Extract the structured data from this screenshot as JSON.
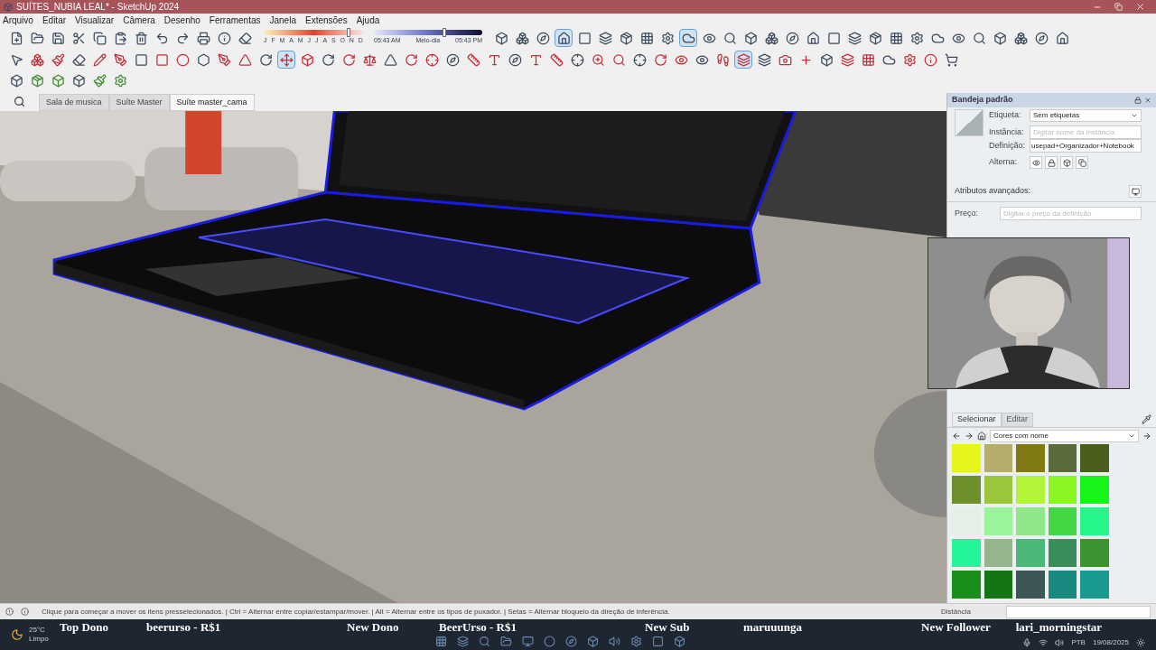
{
  "window": {
    "title": "SUÍTES_NUBIA LEAL* - SketchUp 2024"
  },
  "menu": [
    "Arquivo",
    "Editar",
    "Visualizar",
    "Câmera",
    "Desenho",
    "Ferramentas",
    "Janela",
    "Extensões",
    "Ajuda"
  ],
  "toolbar_rows": [
    {
      "items": [
        {
          "kind": "button",
          "selected": false
        },
        {
          "kind": "button",
          "selected": false
        },
        {
          "kind": "button",
          "selected": false
        },
        {
          "kind": "button",
          "selected": false
        },
        {
          "kind": "button",
          "selected": false
        },
        {
          "kind": "button",
          "selected": false
        },
        {
          "kind": "button",
          "selected": false
        },
        {
          "kind": "button",
          "selected": false
        },
        {
          "kind": "button",
          "selected": false
        },
        {
          "kind": "button",
          "selected": false
        },
        {
          "kind": "button",
          "selected": false
        },
        {
          "kind": "button",
          "selected": false
        },
        {
          "kind": "shadow",
          "month_slider": {
            "labels": [
              "J",
              "F",
              "M",
              "A",
              "M",
              "J",
              "J",
              "A",
              "S",
              "O",
              "N",
              "D"
            ],
            "level": 0.85
          },
          "time_slider": {
            "labels": [
              "05:43 AM",
              "Meio-dia",
              "05:43 PM"
            ],
            "level": 0.65
          }
        },
        {
          "kind": "button",
          "selected": false
        },
        {
          "kind": "button",
          "selected": false
        },
        {
          "kind": "button",
          "selected": false
        },
        {
          "kind": "button",
          "selected": true
        },
        {
          "kind": "button",
          "selected": false
        },
        {
          "kind": "button",
          "selected": false
        },
        {
          "kind": "button",
          "selected": false
        },
        {
          "kind": "button",
          "selected": false
        },
        {
          "kind": "button",
          "selected": false
        },
        {
          "kind": "button",
          "selected": true
        },
        {
          "kind": "button",
          "selected": false
        },
        {
          "kind": "button",
          "selected": false
        },
        {
          "kind": "button",
          "selected": false
        },
        {
          "kind": "button",
          "selected": false
        },
        {
          "kind": "button",
          "selected": false
        },
        {
          "kind": "button",
          "selected": false
        },
        {
          "kind": "button",
          "selected": false
        },
        {
          "kind": "button",
          "selected": false
        },
        {
          "kind": "button",
          "selected": false
        },
        {
          "kind": "button",
          "selected": false
        },
        {
          "kind": "button",
          "selected": false
        },
        {
          "kind": "button",
          "selected": false
        },
        {
          "kind": "button",
          "selected": false
        },
        {
          "kind": "button",
          "selected": false
        },
        {
          "kind": "button",
          "selected": false
        },
        {
          "kind": "button",
          "selected": false
        },
        {
          "kind": "button",
          "selected": false
        },
        {
          "kind": "button",
          "selected": false
        }
      ]
    },
    {
      "items": [
        {
          "kind": "button",
          "selected": false
        },
        {
          "kind": "button",
          "selected": false
        },
        {
          "kind": "button",
          "selected": false
        },
        {
          "kind": "button",
          "selected": false
        },
        {
          "kind": "button",
          "selected": false
        },
        {
          "kind": "button",
          "selected": false
        },
        {
          "kind": "button",
          "selected": false
        },
        {
          "kind": "button",
          "selected": false
        },
        {
          "kind": "button",
          "selected": false
        },
        {
          "kind": "button",
          "selected": false
        },
        {
          "kind": "button",
          "selected": false
        },
        {
          "kind": "button",
          "selected": false
        },
        {
          "kind": "button",
          "selected": false
        },
        {
          "kind": "button",
          "selected": true
        },
        {
          "kind": "button",
          "selected": false
        },
        {
          "kind": "button",
          "selected": false
        },
        {
          "kind": "button",
          "selected": false
        },
        {
          "kind": "button",
          "selected": false
        },
        {
          "kind": "button",
          "selected": false
        },
        {
          "kind": "button",
          "selected": false
        },
        {
          "kind": "button",
          "selected": false
        },
        {
          "kind": "button",
          "selected": false
        },
        {
          "kind": "button",
          "selected": false
        },
        {
          "kind": "button",
          "selected": false
        },
        {
          "kind": "button",
          "selected": false
        },
        {
          "kind": "button",
          "selected": false
        },
        {
          "kind": "button",
          "selected": false
        },
        {
          "kind": "button",
          "selected": false
        },
        {
          "kind": "button",
          "selected": false
        },
        {
          "kind": "button",
          "selected": false
        },
        {
          "kind": "button",
          "selected": false
        },
        {
          "kind": "button",
          "selected": false
        },
        {
          "kind": "button",
          "selected": false
        },
        {
          "kind": "button",
          "selected": false
        },
        {
          "kind": "button",
          "selected": false
        },
        {
          "kind": "button",
          "selected": true
        },
        {
          "kind": "button",
          "selected": false
        },
        {
          "kind": "button",
          "selected": false
        },
        {
          "kind": "button",
          "selected": false
        },
        {
          "kind": "button",
          "selected": false
        },
        {
          "kind": "button",
          "selected": false
        },
        {
          "kind": "button",
          "selected": false
        },
        {
          "kind": "button",
          "selected": false
        },
        {
          "kind": "button",
          "selected": false
        },
        {
          "kind": "button",
          "selected": false
        },
        {
          "kind": "button",
          "selected": false
        }
      ]
    },
    {
      "items": [
        {
          "kind": "button",
          "selected": false
        },
        {
          "kind": "button",
          "selected": false
        },
        {
          "kind": "button",
          "selected": false
        },
        {
          "kind": "button",
          "selected": false
        },
        {
          "kind": "button",
          "selected": false
        },
        {
          "kind": "button",
          "selected": false
        }
      ]
    }
  ],
  "scene_tabs": [
    {
      "label": "Sala de musica",
      "selected": false
    },
    {
      "label": "Suíte Master",
      "selected": false
    },
    {
      "label": "Suíte master_cama",
      "selected": true
    }
  ],
  "tray": {
    "title": "Bandeja padrão",
    "entity": {
      "tag_label": "Etiqueta:",
      "tag_value": "Sem etiquetas",
      "instance_label": "Instância:",
      "instance_placeholder": "Digitar nome da instância",
      "definition_label": "Definição:",
      "definition_value": "usepad+Organizador+Notebook",
      "toggle_label": "Alterna:"
    },
    "advanced": {
      "title": "Atributos avançados:",
      "price_label": "Preço:",
      "price_placeholder": "Digitar o preço da definição"
    },
    "materials": {
      "tabs": [
        {
          "label": "Selecionar",
          "selected": true
        },
        {
          "label": "Editar",
          "selected": false
        }
      ],
      "library": "Cores com nome",
      "swatches": [
        {
          "color": "#e8f51a"
        },
        {
          "color": "#b5ad6a"
        },
        {
          "color": "#7f7a12"
        },
        {
          "color": "#5a6a3a"
        },
        {
          "color": "#4a5e1c"
        },
        {
          "color": "#6d8f2c"
        },
        {
          "color": "#9bc63c"
        },
        {
          "color": "#b2f43a"
        },
        {
          "color": "#8cf622"
        },
        {
          "color": "#17f51a"
        },
        {
          "color": "#e6efe6"
        },
        {
          "color": "#9af49a"
        },
        {
          "color": "#8ee88a"
        },
        {
          "color": "#45d645"
        },
        {
          "color": "#26f58a"
        },
        {
          "color": "#25f59a"
        },
        {
          "color": "#95b58f"
        },
        {
          "color": "#4bb87a"
        },
        {
          "color": "#3a8e5c"
        },
        {
          "color": "#3b9430"
        },
        {
          "color": "#1a8e1a"
        },
        {
          "color": "#157414"
        },
        {
          "color": "#3d5656"
        },
        {
          "color": "#1a8a80"
        },
        {
          "color": "#1a9a8e"
        }
      ]
    }
  },
  "status_bar": {
    "message": "Clique para começar a mover os itens presselecionados. | Ctrl = Alternar entre copiar/estampar/mover. | Alt = Alternar entre os tipos de puxador. | Setas = Alternar bloqueio da direção de inferência.",
    "measure_label": "Distância"
  },
  "taskbar": {
    "temperature": "25°C",
    "weather": "Limpo",
    "language": "PTB",
    "date": "19/08/2025"
  },
  "stream_overlay": [
    {
      "label": "Top Dono",
      "name": "beerurso - R$1"
    },
    {
      "label": "New Dono",
      "name": "BeerUrso - R$1"
    },
    {
      "label": "New Sub",
      "name": "maruuunga"
    },
    {
      "label": "New Follower",
      "name": "lari_morningstar"
    }
  ]
}
